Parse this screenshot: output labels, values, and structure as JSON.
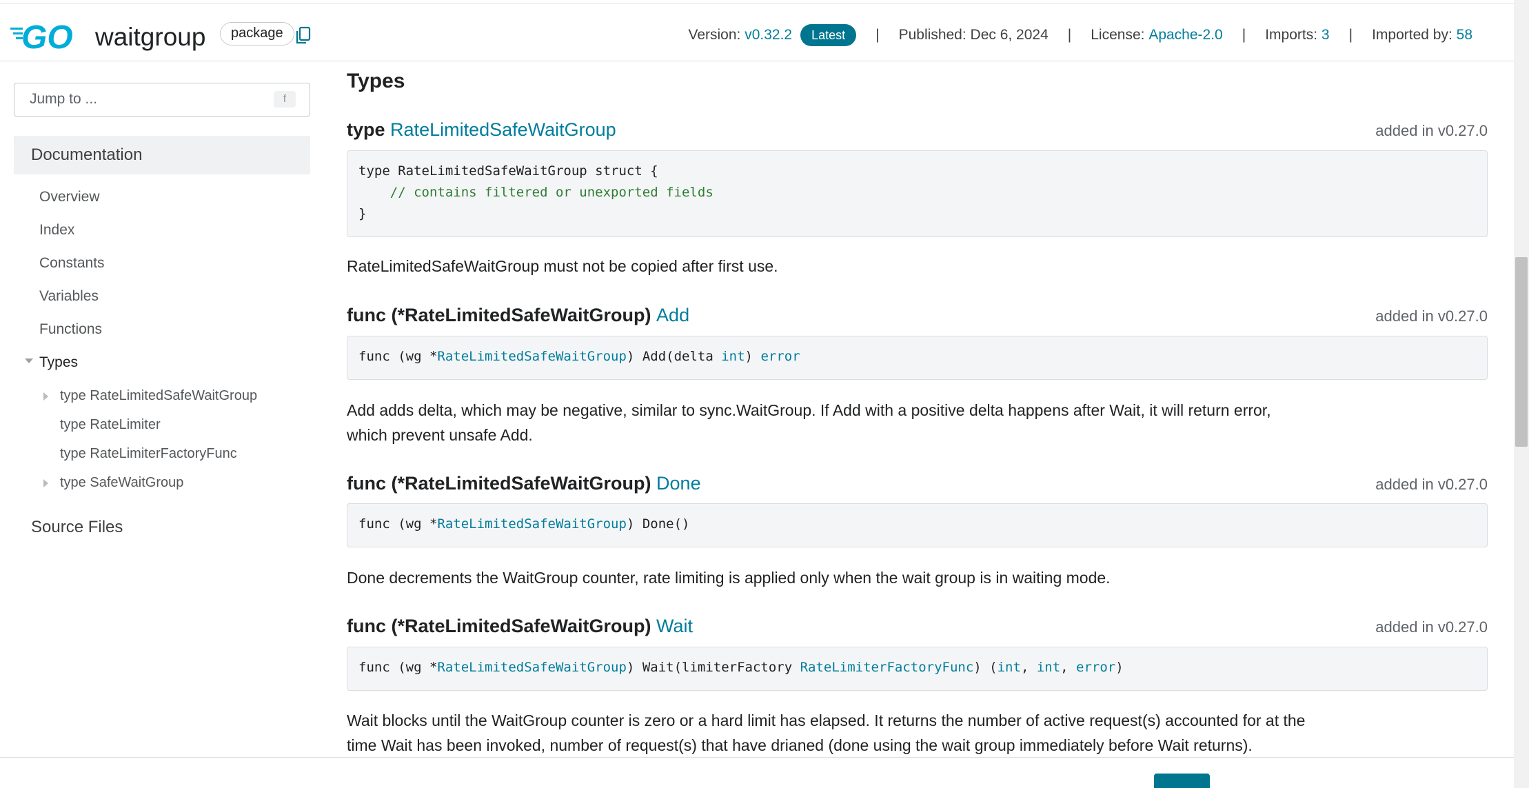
{
  "header": {
    "logo_text": "GO",
    "title": "waitgroup",
    "badge": "package",
    "version_label": "Version:",
    "version": "v0.32.2",
    "latest": "Latest",
    "published": "Published: Dec 6, 2024",
    "license_label": "License:",
    "license": "Apache-2.0",
    "imports_label": "Imports:",
    "imports": "3",
    "imported_by_label": "Imported by:",
    "imported_by": "58",
    "separator": "|"
  },
  "sidebar": {
    "jump_placeholder": "Jump to ...",
    "jump_key": "f",
    "documentation": "Documentation",
    "items": [
      "Overview",
      "Index",
      "Constants",
      "Variables",
      "Functions",
      "Types"
    ],
    "type_items": [
      "type RateLimitedSafeWaitGroup",
      "type RateLimiter",
      "type RateLimiterFactoryFunc",
      "type SafeWaitGroup"
    ],
    "source_files": "Source Files"
  },
  "main": {
    "section_title": "Types",
    "type_decl": {
      "keyword": "type",
      "name": "RateLimitedSafeWaitGroup",
      "added": "added in v0.27.0",
      "code_line1": "type RateLimitedSafeWaitGroup struct {",
      "code_comment": "    // contains filtered or unexported fields",
      "code_line3": "}",
      "desc": "RateLimitedSafeWaitGroup must not be copied after first use."
    },
    "add": {
      "prefix": "func (*RateLimitedSafeWaitGroup)",
      "name": "Add",
      "added": "added in v0.27.0",
      "code_a": "func (wg *",
      "code_recv": "RateLimitedSafeWaitGroup",
      "code_b": ") Add(delta ",
      "code_int": "int",
      "code_c": ") ",
      "code_err": "error",
      "desc": "Add adds delta, which may be negative, similar to sync.WaitGroup. If Add with a positive delta happens after Wait, it will return error, which prevent unsafe Add."
    },
    "done": {
      "prefix": "func (*RateLimitedSafeWaitGroup)",
      "name": "Done",
      "added": "added in v0.27.0",
      "code_a": "func (wg *",
      "code_recv": "RateLimitedSafeWaitGroup",
      "code_b": ") Done()",
      "desc": "Done decrements the WaitGroup counter, rate limiting is applied only when the wait group is in waiting mode."
    },
    "wait": {
      "prefix": "func (*RateLimitedSafeWaitGroup)",
      "name": "Wait",
      "added": "added in v0.27.0",
      "code_a": "func (wg *",
      "code_recv": "RateLimitedSafeWaitGroup",
      "code_b": ") Wait(limiterFactory ",
      "code_factory": "RateLimiterFactoryFunc",
      "code_c": ") (",
      "code_int1": "int",
      "code_comma1": ", ",
      "code_int2": "int",
      "code_comma2": ", ",
      "code_err": "error",
      "code_d": ")",
      "desc": "Wait blocks until the WaitGroup counter is zero or a hard limit has elapsed. It returns the number of active request(s) accounted for at the time Wait has been invoked, number of request(s) that have drianed (done using the wait group immediately before Wait returns)."
    }
  },
  "colors": {
    "link": "#007d9c",
    "latest_badge": "#00758f",
    "go_logo": "#00add8"
  }
}
